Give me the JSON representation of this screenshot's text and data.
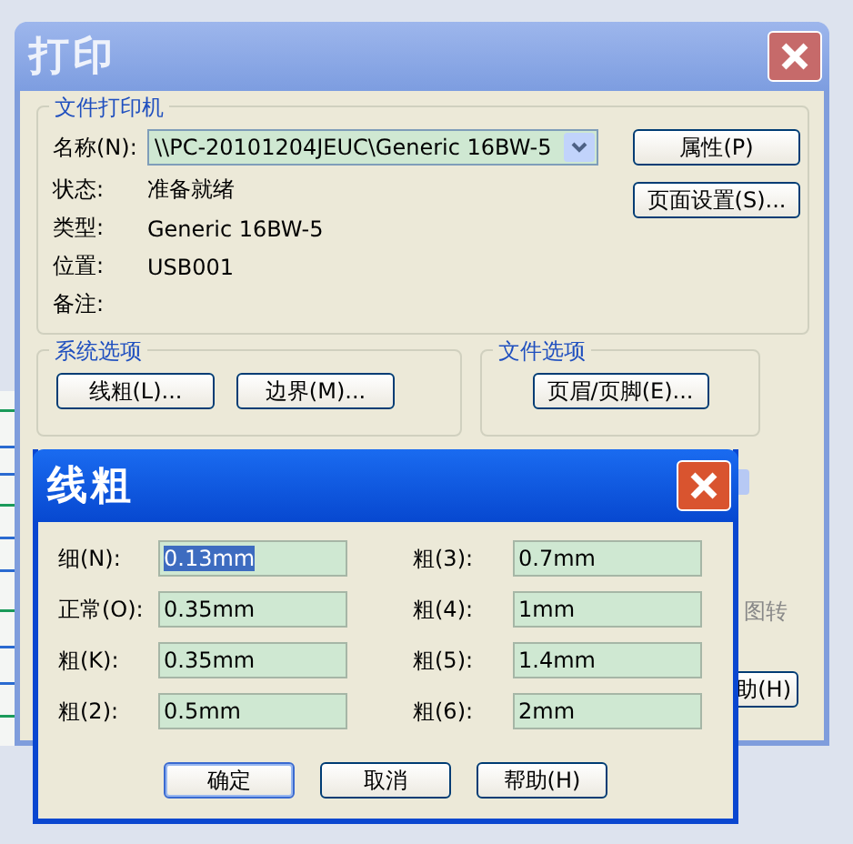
{
  "print_dialog": {
    "title": "打印",
    "printer_group": {
      "title": "文件打印机",
      "name_label": "名称(N):",
      "name_value": "\\\\PC-20101204JEUC\\Generic 16BW-5",
      "buttons": [
        "属性(P)",
        "页面设置(S)..."
      ],
      "info": [
        {
          "label": "状态:",
          "value": "准备就绪"
        },
        {
          "label": "类型:",
          "value": "Generic 16BW-5"
        },
        {
          "label": "位置:",
          "value": "USB001"
        },
        {
          "label": "备注:"
        }
      ]
    },
    "system_group": {
      "title": "系统选项",
      "buttons": [
        "线粗(L)...",
        "边界(M)..."
      ]
    },
    "file_group": {
      "title": "文件选项",
      "buttons": [
        "页眉/页脚(E)..."
      ]
    },
    "partial_label": "图转",
    "partial_button": "助(H)"
  },
  "line_weight_dialog": {
    "title": "线粗",
    "fields": [
      {
        "label": "细(N):",
        "value": "0.13mm",
        "selected": true
      },
      {
        "label": "正常(O):",
        "value": "0.35mm",
        "selected": false
      },
      {
        "label": "粗(K):",
        "value": "0.35mm",
        "selected": false
      },
      {
        "label": "粗(2):",
        "value": "0.5mm",
        "selected": false
      },
      {
        "label": "粗(3):",
        "value": "0.7mm",
        "selected": false
      },
      {
        "label": "粗(4):",
        "value": "1mm",
        "selected": false
      },
      {
        "label": "粗(5):",
        "value": "1.4mm",
        "selected": false
      },
      {
        "label": "粗(6):",
        "value": "2mm",
        "selected": false
      }
    ],
    "buttons": [
      {
        "label": "确定",
        "default": true
      },
      {
        "label": "取消",
        "default": false
      },
      {
        "label": "帮助(H)",
        "default": false
      }
    ]
  }
}
